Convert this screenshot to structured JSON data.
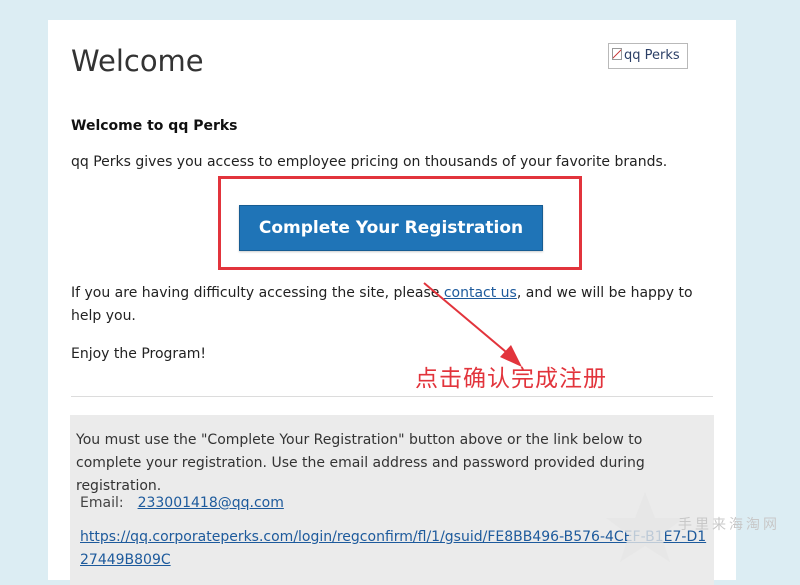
{
  "email": {
    "title": "Welcome",
    "logo_alt": "qq Perks",
    "greeting": "Welcome to qq Perks",
    "intro": "qq Perks gives you access to employee pricing on thousands of your favorite brands.",
    "cta_label": "Complete Your Registration",
    "help_before": "If you are having difficulty accessing the site, please ",
    "help_link": "contact us",
    "help_after": ", and we will be happy to help you.",
    "closing": "Enjoy the Program!",
    "note": "You must use the \"Complete Your Registration\" button above or the link below to complete your registration. Use the email address and password provided during registration.",
    "email_label": "Email:",
    "email_value": "233001418@qq.com",
    "confirm_url": "https://qq.corporateperks.com/login/regconfirm/fl/1/gsuid/FE8BB496-B576-4CEF-B1E7-D127449B809C"
  },
  "annotation": {
    "text": "点击确认完成注册",
    "color": "#e2343c"
  },
  "watermark": {
    "text": "手里来海淘网"
  },
  "colors": {
    "background": "#dcedf3",
    "button": "#1f74b7",
    "link": "#1d5a9c",
    "highlight": "#e2343c"
  }
}
